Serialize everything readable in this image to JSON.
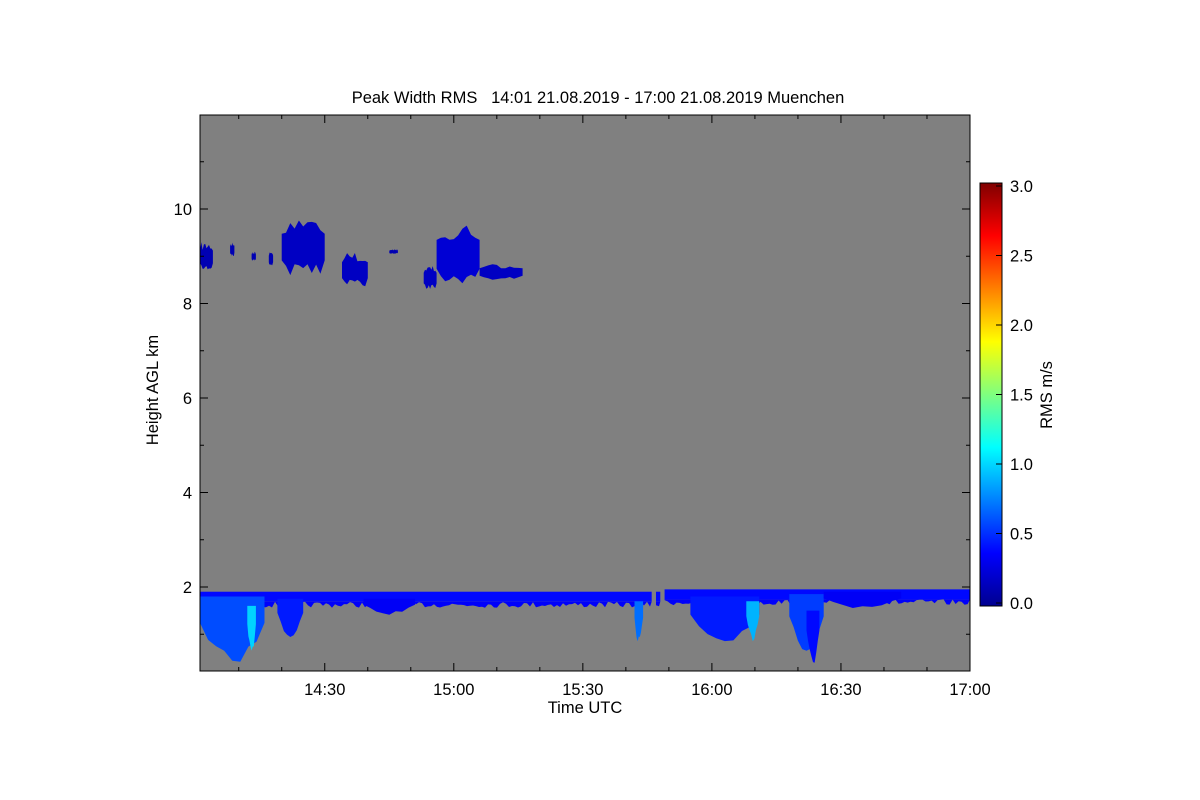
{
  "chart_data": {
    "type": "heatmap",
    "title": "Peak Width RMS   14:01 21.08.2019 - 17:00 21.08.2019 Muenchen",
    "xlabel": "Time UTC",
    "ylabel": "Height AGL km",
    "xlim": [
      "14:01",
      "17:00"
    ],
    "ylim": [
      0.2,
      12.0
    ],
    "x_ticks": [
      "14:30",
      "15:00",
      "15:30",
      "16:00",
      "16:30",
      "17:00"
    ],
    "y_ticks": [
      2,
      4,
      6,
      8,
      10
    ],
    "no_data_color": "#808080",
    "colorbar": {
      "label": "RMS m/s",
      "range": [
        0.0,
        3.0
      ],
      "ticks": [
        "0.0",
        "0.5",
        "1.0",
        "1.5",
        "2.0",
        "2.5",
        "3.0"
      ],
      "colormap": "jet"
    },
    "cirrus_cells": [
      {
        "t_start": "14:01",
        "t_end": "14:04",
        "h_bottom": 8.7,
        "h_top": 9.3,
        "rms": 0.15
      },
      {
        "t_start": "14:08",
        "t_end": "14:09",
        "h_bottom": 9.0,
        "h_top": 9.3,
        "rms": 0.15
      },
      {
        "t_start": "14:13",
        "t_end": "14:14",
        "h_bottom": 8.9,
        "h_top": 9.1,
        "rms": 0.15
      },
      {
        "t_start": "14:17",
        "t_end": "14:18",
        "h_bottom": 8.8,
        "h_top": 9.1,
        "rms": 0.15
      },
      {
        "t_start": "14:20",
        "t_end": "14:30",
        "h_bottom": 8.6,
        "h_top": 9.85,
        "rms": 0.2
      },
      {
        "t_start": "14:34",
        "t_end": "14:40",
        "h_bottom": 8.35,
        "h_top": 9.1,
        "rms": 0.2
      },
      {
        "t_start": "14:45",
        "t_end": "14:47",
        "h_bottom": 9.05,
        "h_top": 9.15,
        "rms": 0.15
      },
      {
        "t_start": "14:53",
        "t_end": "14:56",
        "h_bottom": 8.3,
        "h_top": 8.8,
        "rms": 0.2
      },
      {
        "t_start": "14:56",
        "t_end": "15:06",
        "h_bottom": 8.4,
        "h_top": 9.75,
        "rms": 0.25
      },
      {
        "t_start": "15:06",
        "t_end": "15:16",
        "h_bottom": 8.5,
        "h_top": 8.85,
        "rms": 0.2
      }
    ],
    "boundary_layer": [
      {
        "t_start": "14:01",
        "t_end": "15:46",
        "h_top": 1.9,
        "rms": 0.4
      },
      {
        "t_start": "15:47",
        "t_end": "15:48",
        "h_top": 1.9,
        "rms": 0.4
      },
      {
        "t_start": "15:49",
        "t_end": "17:00",
        "h_top": 1.95,
        "rms": 0.4
      }
    ],
    "plumes": [
      {
        "t_start": "14:01",
        "t_end": "14:16",
        "h_bottom": 0.2,
        "h_top": 1.8,
        "rms": 0.6
      },
      {
        "t_start": "14:12",
        "t_end": "14:14",
        "h_bottom": 0.5,
        "h_top": 1.6,
        "rms": 1.0
      },
      {
        "t_start": "14:19",
        "t_end": "14:25",
        "h_bottom": 0.9,
        "h_top": 1.75,
        "rms": 0.45
      },
      {
        "t_start": "14:39",
        "t_end": "14:51",
        "h_bottom": 1.4,
        "h_top": 1.75,
        "rms": 0.35
      },
      {
        "t_start": "15:42",
        "t_end": "15:44",
        "h_bottom": 0.7,
        "h_top": 1.7,
        "rms": 0.7
      },
      {
        "t_start": "15:55",
        "t_end": "16:11",
        "h_bottom": 0.7,
        "h_top": 1.8,
        "rms": 0.45
      },
      {
        "t_start": "16:08",
        "t_end": "16:11",
        "h_bottom": 0.8,
        "h_top": 1.7,
        "rms": 0.9
      },
      {
        "t_start": "16:18",
        "t_end": "16:26",
        "h_bottom": 0.5,
        "h_top": 1.85,
        "rms": 0.55
      },
      {
        "t_start": "16:22",
        "t_end": "16:25",
        "h_bottom": 0.3,
        "h_top": 1.5,
        "rms": 0.4
      },
      {
        "t_start": "16:26",
        "t_end": "16:44",
        "h_bottom": 1.5,
        "h_top": 1.9,
        "rms": 0.35
      }
    ]
  }
}
